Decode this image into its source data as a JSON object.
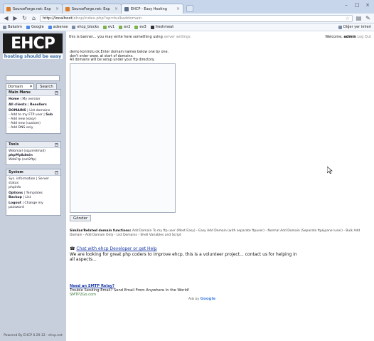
{
  "browser": {
    "tabs": [
      {
        "label": "SourceForge.net: Exp"
      },
      {
        "label": "SourceForge.net: Exp"
      },
      {
        "label": "EHCP - Easy Hosting"
      }
    ],
    "url_host": "http://localhost",
    "url_rest": "/ehcp/index.php?op=bulkaddomain",
    "bookmarks": [
      "Bakalım",
      "Google",
      "adsense",
      "ehcp_blocks",
      "ev1",
      "ev2",
      "ev3",
      "freshmeat"
    ],
    "other_bookmarks": "Diğer yer imleri"
  },
  "sidebar": {
    "logo_text": "EHCP",
    "tagline": "hosting should be easy",
    "search_select": "Domain",
    "search_button": "Search",
    "main_menu": {
      "title": "Main Menu",
      "home": "Home",
      "my_version": "My version",
      "all_clients": "All clients",
      "resellers": "Resellers",
      "domains": "DOMAINS",
      "list_domains": "List domains",
      "add_ftp": "- Add to my FTP user",
      "sub": "Sub",
      "add_easy": "- Add new (easy)",
      "add_new": "- Add new (custom)",
      "add_dns": "- Add DNS only"
    },
    "tools": {
      "title": "Tools",
      "webmail": "Webmail (squirrelmail)",
      "phpmyadmin": "phpMyAdmin",
      "webftp": "WebFtp (net2ftp)"
    },
    "system": {
      "title": "System",
      "line1": "Sys. information",
      "server_status": "Server status",
      "phpinfo": "phpinfo",
      "options": "Options",
      "templates": "Templates",
      "backup": "Backup",
      "list": "List",
      "logout": "Logout",
      "change_pw": "Change my password"
    },
    "footer": "Powered By EHCP 0.29.12 · ehcp.net"
  },
  "main": {
    "banner": "this is banner... you may write here something using",
    "banner_link": "server settings",
    "welcome": "Welcome,",
    "user": "admin",
    "logout": "Log Out",
    "instructions": [
      "demo kontrolu ok.Enter domain names below one by one.",
      "don't enter www. at start of domains.",
      "All domains will be setup under your ftp directory."
    ],
    "submit": "Gönder",
    "similar_label": "Similar/Related domain functions:",
    "similar_links": "Add Domain To my ftp user (Most Easy) - Easy Add Domain (with separate ftpuser) - Normal Add Domain (Separate ftp&panel user) - Bulk Add Domain - Add Domain Only - List Domains - Shell Variables and Script",
    "chat_link": "Chat with ehcp Developer or get Help",
    "chat_text": "We are looking for great php coders to improve ehcp, this is a volunteer project... contact us for helping in all aspects...",
    "ad_title": "Need an SMTP Relay?",
    "ad_text": "Trouble Sending Email? Send Email From Anywhere In the World!",
    "ad_url": "SMTP2Go.com",
    "ads_by": "Ads by",
    "google": "Google"
  }
}
